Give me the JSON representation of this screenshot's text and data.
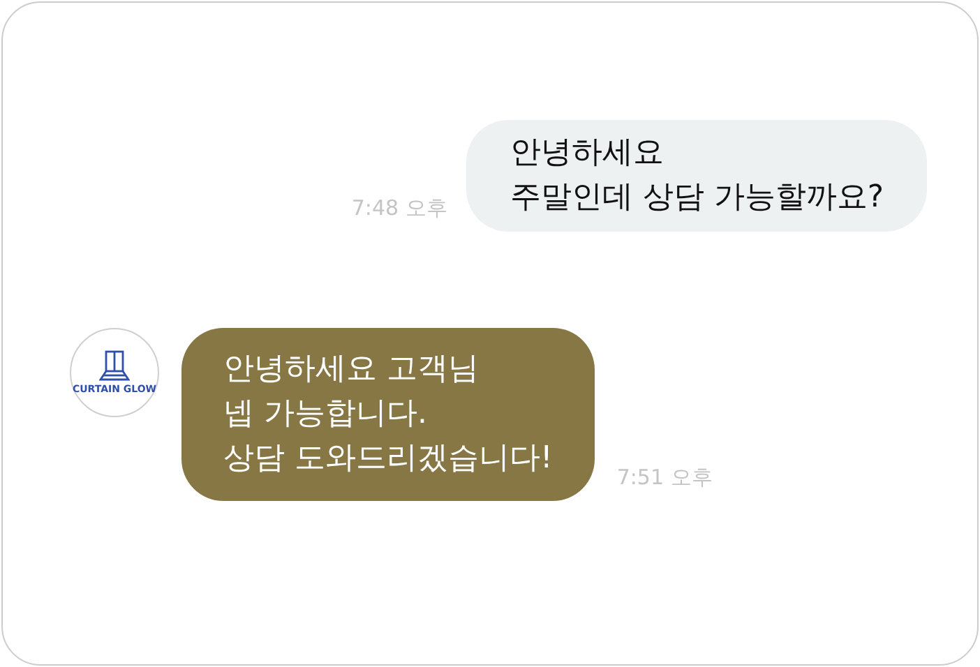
{
  "messages": [
    {
      "kind": "outgoing",
      "lines": [
        "안녕하세요",
        "주말인데 상담 가능할까요?"
      ],
      "time": "7:48 오후"
    },
    {
      "kind": "incoming",
      "avatar": {
        "logo_text": "CURTAIN GLOW"
      },
      "lines": [
        "안녕하세요 고객님",
        "넵 가능합니다.",
        "상담 도와드리겠습니다!"
      ],
      "time": "7:51 오후"
    }
  ]
}
